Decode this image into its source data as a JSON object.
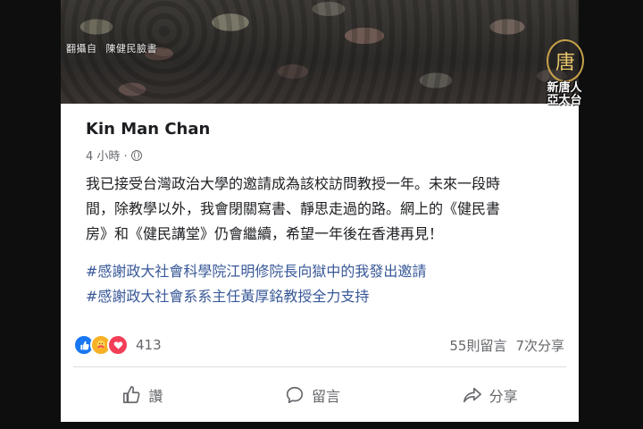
{
  "photo": {
    "credit_prefix": "翻攝自",
    "credit_source": "陳健民臉書"
  },
  "post": {
    "author": "Kin Man Chan",
    "time": "4 小時 ·",
    "body_lines": [
      "我已接受台灣政治大學的邀請成為該校訪問教授一年。未來一段時",
      "間，除教學以外，我會閉關寫書、靜思走過的路。網上的《健民書",
      "房》和《健民講堂》仍會繼續，希望一年後在香港再見！"
    ],
    "hashtags": [
      "#感謝政大社會科學院江明修院長向獄中的我發出邀請",
      "#感謝政大社會系系主任黃厚銘教授全力支持"
    ]
  },
  "stats": {
    "reaction_count": "413",
    "reaction_icons": [
      "like-icon",
      "care-icon",
      "love-icon"
    ],
    "comments": "55則留言",
    "shares": "7次分享"
  },
  "actions": {
    "like_label": "讚",
    "comment_label": "留言",
    "share_label": "分享"
  },
  "watermark": {
    "seal_char": "唐",
    "brand_line1": "新唐人",
    "brand_line2": "亞太台"
  },
  "colors": {
    "hashtag": "#385898",
    "like_blue": "#1877f2",
    "love_red": "#f33e58",
    "care_yellow": "#f7b125",
    "meta_gray": "#65676b"
  }
}
